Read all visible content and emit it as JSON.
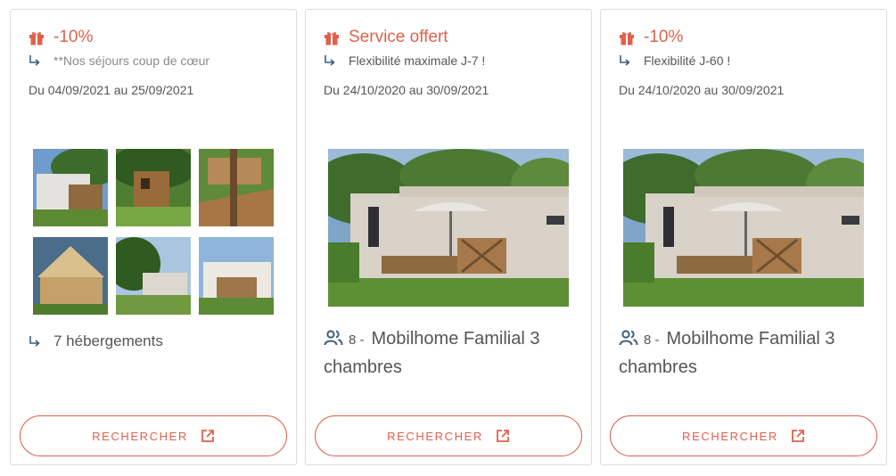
{
  "colors": {
    "accent": "#e0614b",
    "icon_blue": "#3d5f7a",
    "text": "#555555",
    "border": "#dcdcdc"
  },
  "cards": [
    {
      "offer": "-10%",
      "subtitle": "**Nos séjours coup de cœur",
      "dates": "Du 04/09/2021 au 25/09/2021",
      "thumb_count": 6,
      "count_label": "7 hébergements",
      "button": "RECHERCHER"
    },
    {
      "offer": "Service offert",
      "subtitle": "Flexibilité maximale J-7 !",
      "dates": "Du 24/10/2020 au 30/09/2021",
      "capacity": "8 -",
      "lodging_name": "Mobilhome Familial 3 chambres",
      "button": "RECHERCHER"
    },
    {
      "offer": "-10%",
      "subtitle": "Flexibilité J-60 !",
      "dates": "Du 24/10/2020 au 30/09/2021",
      "capacity": "8 -",
      "lodging_name": "Mobilhome Familial 3 chambres",
      "button": "RECHERCHER"
    }
  ],
  "icons": {
    "gift": "gift-icon",
    "arrow": "arrow-return-icon",
    "people": "people-icon",
    "external": "external-link-icon"
  }
}
